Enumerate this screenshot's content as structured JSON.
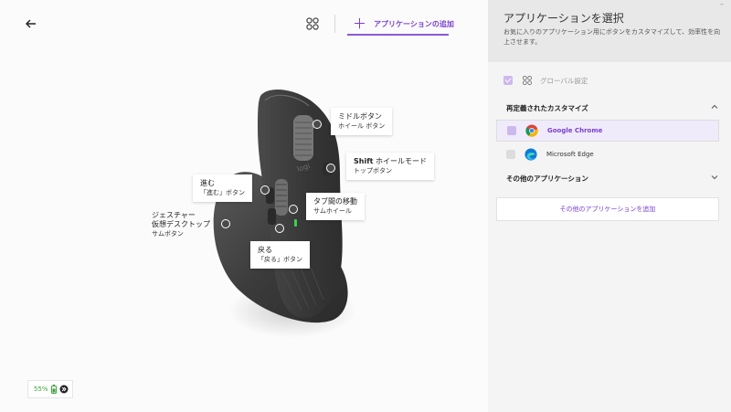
{
  "header": {
    "add_app_label": "アプリケーションの追加",
    "plus_glyph": "＋",
    "back_glyph": "←"
  },
  "callouts": {
    "middle": {
      "title": "ミドルボタン",
      "sub": "ホイール ボタン"
    },
    "shift": {
      "title_bold": "Shift",
      "title_rest": " ホイールモード",
      "sub": "トップボタン"
    },
    "forward": {
      "title": "進む",
      "sub": "「進む」ボタン"
    },
    "tab": {
      "title": "タブ間の移動",
      "sub": "サムホイール"
    },
    "gesture": {
      "title": "ジェスチャー",
      "line2": "仮想デスクトップ",
      "sub": "サムボタン"
    },
    "back": {
      "title": "戻る",
      "sub": "「戻る」ボタン"
    }
  },
  "battery": {
    "percent": "55%"
  },
  "panel": {
    "title": "アプリケーションを選択",
    "description": "お気に入りのアプリケーション用にボタンをカスタマイズして、効率性を向上させます。",
    "minimize": "–",
    "global_label": "グローバル設定",
    "customized_heading": "再定義されたカスタマイズ",
    "apps": [
      {
        "name": "Google Chrome",
        "selected": true
      },
      {
        "name": "Microsoft Edge",
        "selected": false
      }
    ],
    "other_heading": "その他のアプリケーション",
    "add_other_label": "その他のアプリケーションを追加"
  },
  "colors": {
    "accent": "#7a3fd1",
    "hotspot": "#4a4a4a",
    "battery_green": "#3ba53b",
    "panel_bg": "#f4f4f4"
  }
}
